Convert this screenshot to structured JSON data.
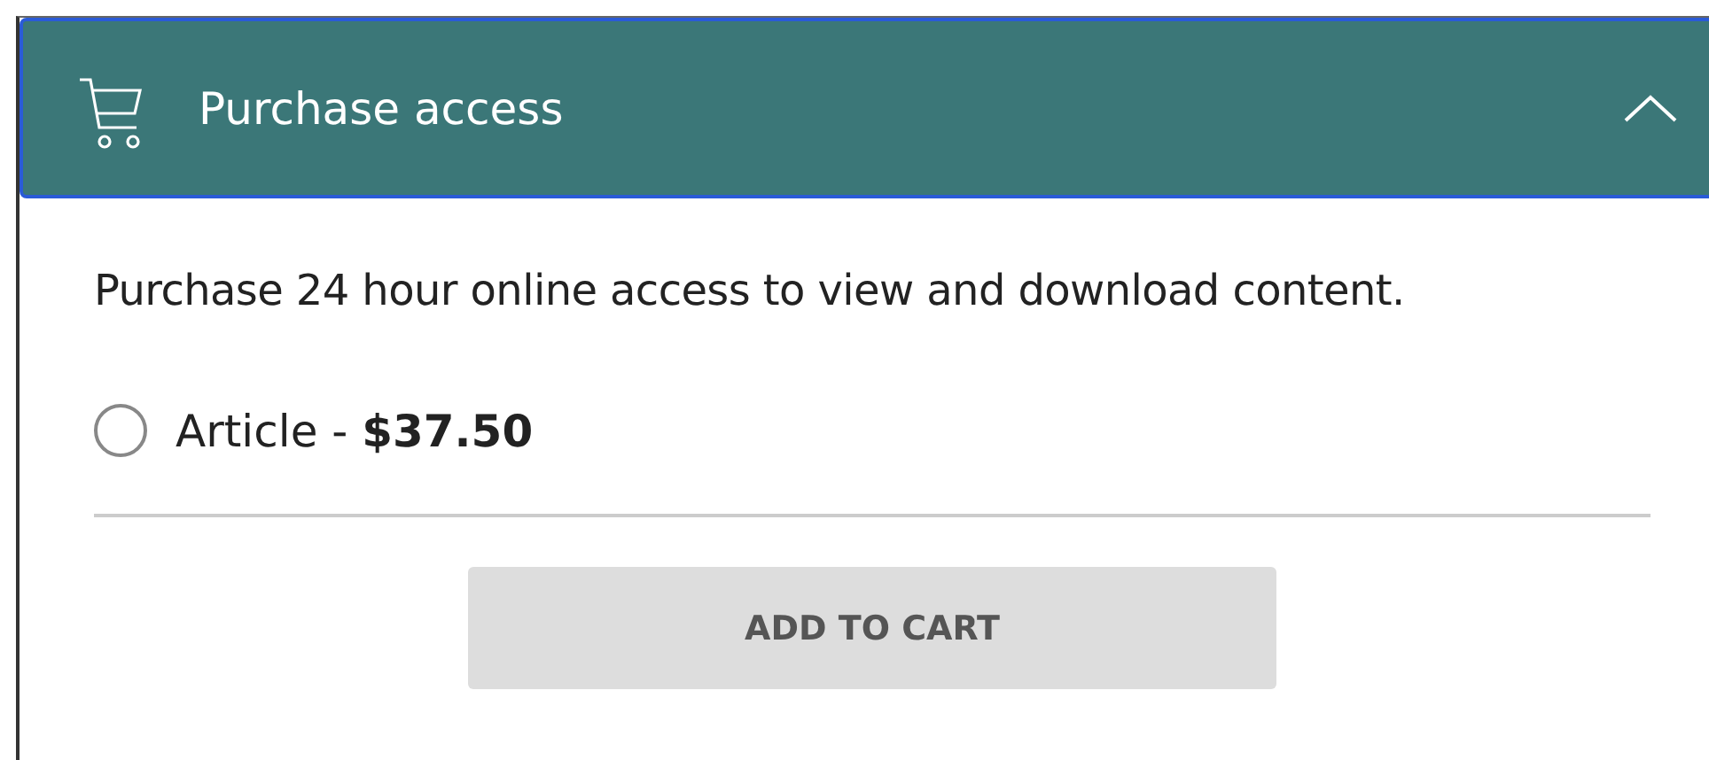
{
  "header": {
    "title": "Purchase access",
    "expanded": true
  },
  "description": "Purchase 24 hour online access to view and download content.",
  "options": [
    {
      "label": "Article - **$37.50**",
      "selected": false
    }
  ],
  "button": {
    "label": "ADD TO CART",
    "disabled": true
  }
}
